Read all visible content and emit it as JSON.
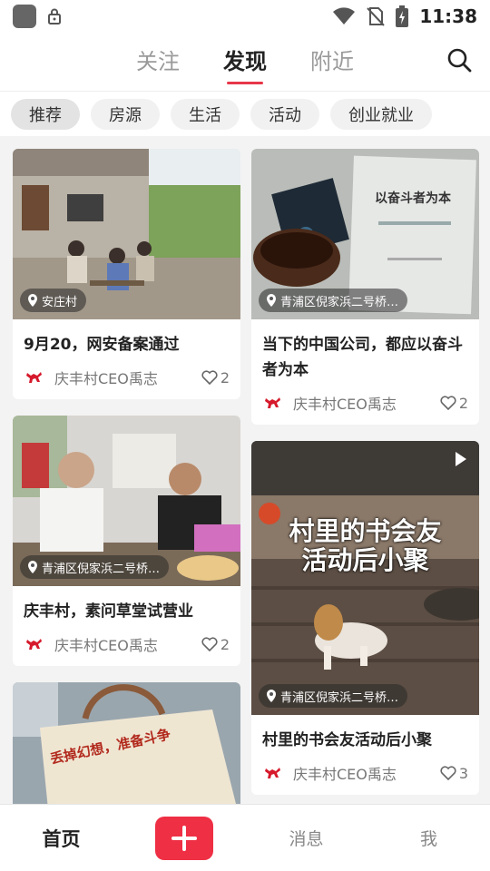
{
  "status_bar": {
    "time": "11:38"
  },
  "top_nav": {
    "tabs": [
      {
        "label": "关注"
      },
      {
        "label": "发现"
      },
      {
        "label": "附近"
      }
    ],
    "active_tab": "发现"
  },
  "chips": [
    {
      "label": "推荐"
    },
    {
      "label": "房源"
    },
    {
      "label": "生活"
    },
    {
      "label": "活动"
    },
    {
      "label": "创业就业"
    }
  ],
  "feed": {
    "cards": [
      {
        "location": "安庄村",
        "title": "9月20，网安备案通过",
        "author": "庆丰村CEO禹志",
        "likes": "2"
      },
      {
        "location": "青浦区倪家浜二号桥…",
        "title": "当下的中国公司，都应以奋斗者为本",
        "author": "庆丰村CEO禹志",
        "likes": "2",
        "image_text": "以奋斗者为本"
      },
      {
        "location": "青浦区倪家浜二号桥…",
        "title": "庆丰村，素问草堂试营业",
        "author": "庆丰村CEO禹志",
        "likes": "2"
      },
      {
        "location": "青浦区倪家浜二号桥…",
        "title": "村里的书会友活动后小聚",
        "author": "庆丰村CEO禹志",
        "likes": "3",
        "overlay_line1": "村里的书会友",
        "overlay_line2": "活动后小聚",
        "is_video": true
      },
      {
        "image_text": "丢掉幻想，准备斗争"
      }
    ]
  },
  "bottom_nav": {
    "home": "首页",
    "messages": "消息",
    "me": "我"
  },
  "colors": {
    "accent": "#ef2f44",
    "author_icon": "#d61a2c"
  }
}
